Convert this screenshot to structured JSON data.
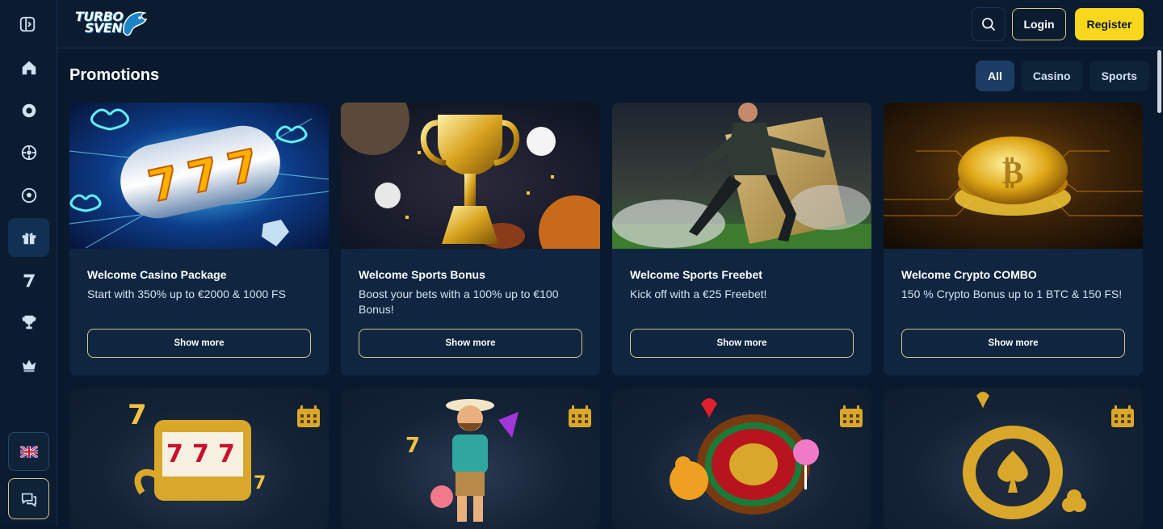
{
  "brand": {
    "logo_line1": "TURBO",
    "logo_line2": "SVEN"
  },
  "sidebar": {
    "items": [
      {
        "icon": "home-icon"
      },
      {
        "icon": "casino-chip-icon"
      },
      {
        "icon": "roulette-icon"
      },
      {
        "icon": "football-icon"
      },
      {
        "icon": "gift-icon",
        "active": true
      },
      {
        "icon": "seven-icon"
      },
      {
        "icon": "trophy-icon"
      },
      {
        "icon": "crown-icon"
      }
    ],
    "language_icon": "uk-flag-icon",
    "chat_icon": "chat-icon"
  },
  "header": {
    "login_label": "Login",
    "register_label": "Register"
  },
  "page": {
    "title": "Promotions"
  },
  "filters": [
    {
      "label": "All",
      "active": true
    },
    {
      "label": "Casino",
      "active": false
    },
    {
      "label": "Sports",
      "active": false
    }
  ],
  "promotions": [
    {
      "title": "Welcome Casino Package",
      "description": "Start with 350% up to €2000 & 1000 FS",
      "button": "Show more"
    },
    {
      "title": "Welcome Sports Bonus",
      "description": "Boost your bets with a 100% up to €100 Bonus!",
      "button": "Show more"
    },
    {
      "title": "Welcome Sports Freebet",
      "description": "Kick off with a €25 Freebet!",
      "button": "Show more"
    },
    {
      "title": "Welcome Crypto COMBO",
      "description": "150 % Crypto Bonus up to 1 BTC & 150 FS!",
      "button": "Show more"
    }
  ],
  "colors": {
    "accent": "#f9d71c",
    "background": "#0a1a2e",
    "card": "#0f2540",
    "button_border": "#d6c78a"
  }
}
